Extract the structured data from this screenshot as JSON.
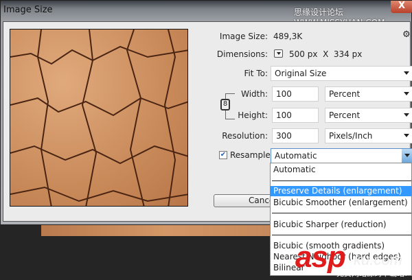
{
  "window": {
    "title": "Image Size",
    "watermark_top": "思缘设计论坛 WWW.MISSYUAN.COM",
    "close_label": "X"
  },
  "info": {
    "image_size_label": "Image Size:",
    "image_size_value": "489,3K",
    "dimensions_label": "Dimensions:",
    "dimensions_value": "500 px  X  334 px"
  },
  "fit_to": {
    "label": "Fit To:",
    "value": "Original Size"
  },
  "width": {
    "label": "Width:",
    "value": "100",
    "unit": "Percent"
  },
  "height": {
    "label": "Height:",
    "value": "100",
    "unit": "Percent"
  },
  "resolution": {
    "label": "Resolution:",
    "value": "300",
    "unit": "Pixels/Inch"
  },
  "resample": {
    "label": "Resample:",
    "checked": true,
    "value": "Automatic",
    "options": [
      "Automatic",
      "Preserve Details (enlargement)",
      "Bicubic Smoother (enlargement)",
      "Bicubic Sharper (reduction)",
      "Bicubic (smooth gradients)",
      "Nearest Neighbor (hard edges)",
      "Bilinear"
    ],
    "selected_highlight": "Preserve Details (enlargement)"
  },
  "buttons": {
    "cancel": "Cancel"
  },
  "watermark": {
    "brand": "asp",
    "domain": "ku.com",
    "tagline": "免费网站源码下载站!"
  }
}
